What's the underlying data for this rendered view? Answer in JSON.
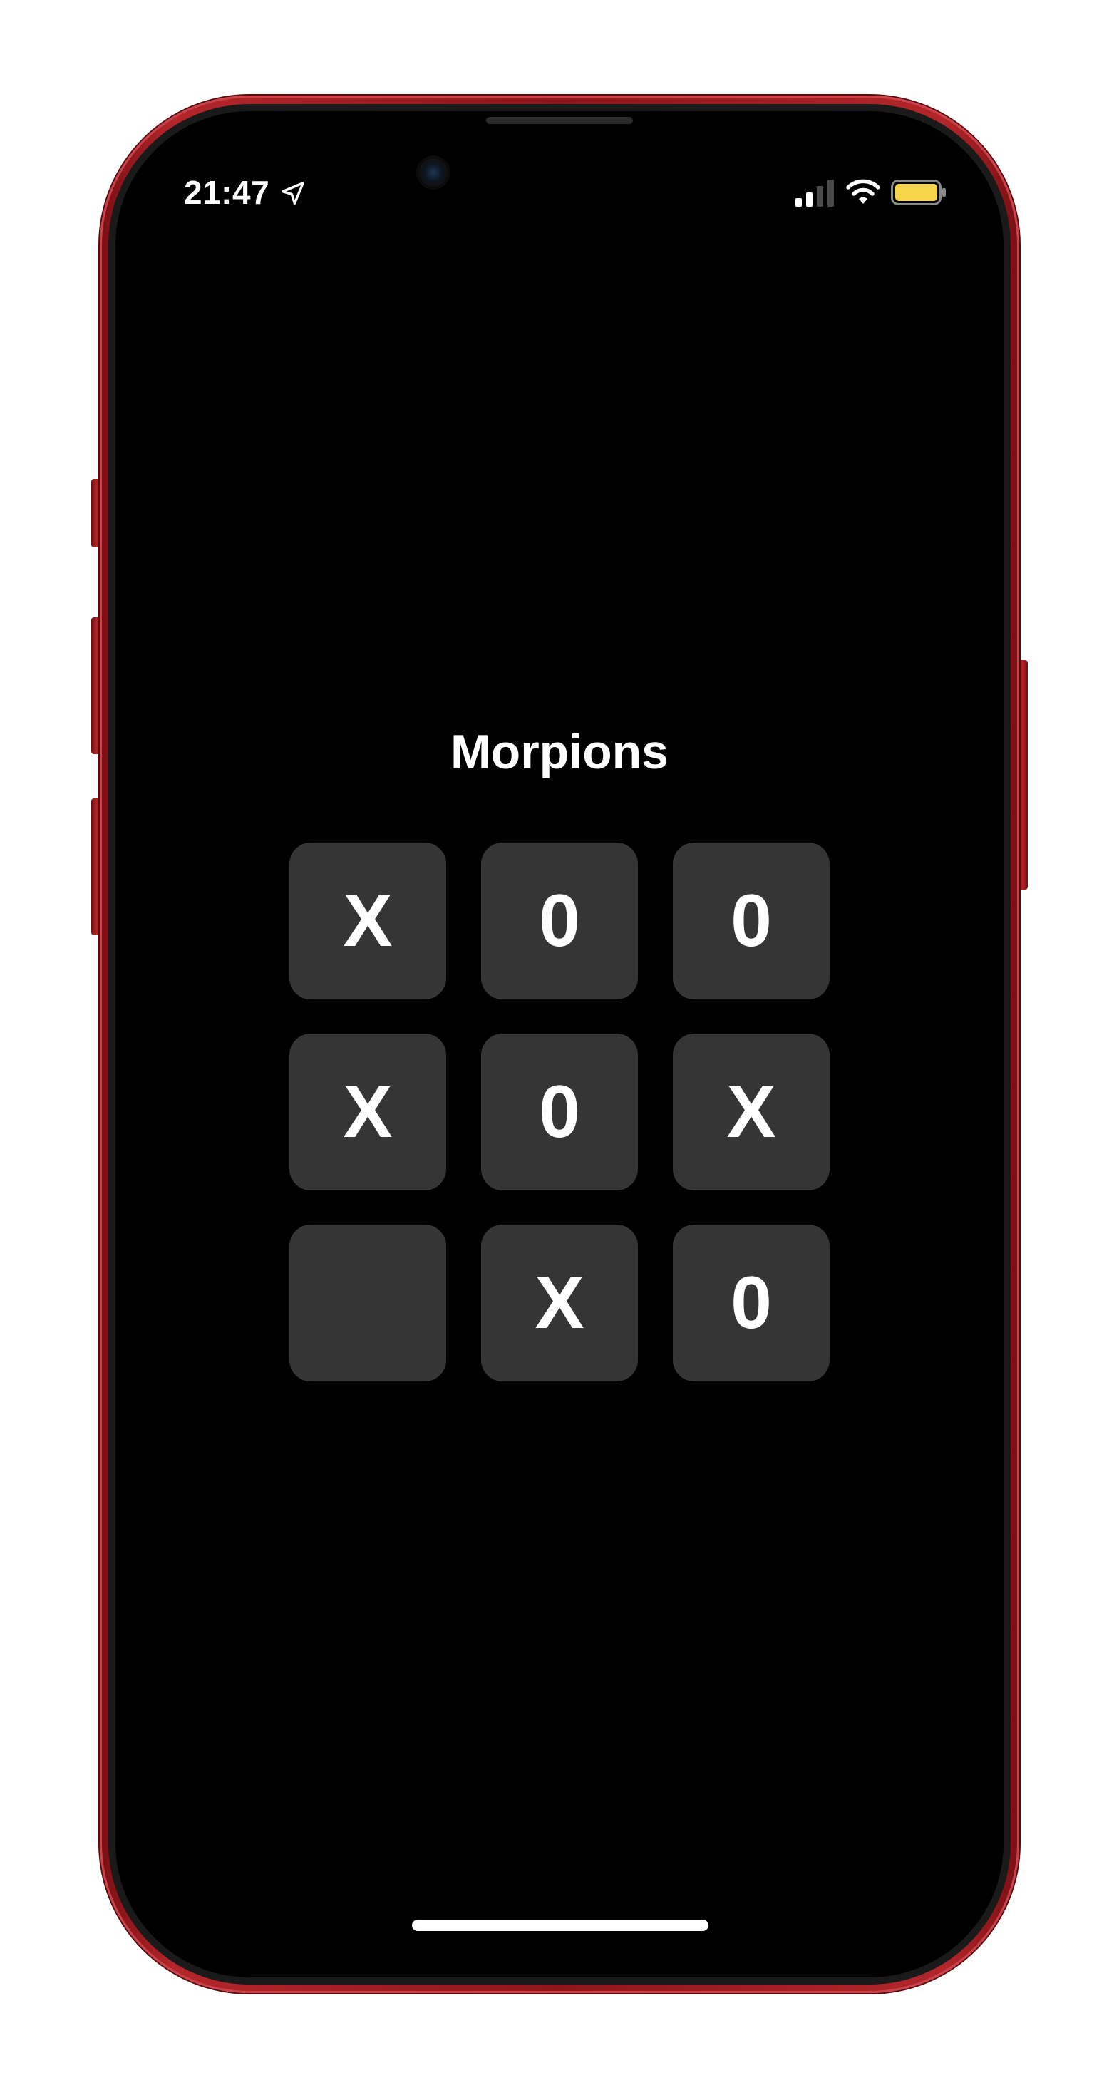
{
  "status_bar": {
    "time": "21:47",
    "icons": [
      "location-arrow-icon",
      "cellular-signal-icon",
      "wifi-icon",
      "battery-icon"
    ],
    "battery_color": "#f5d54a"
  },
  "device": {
    "frame_color": "#b3262b",
    "screen_color": "#000000"
  },
  "game": {
    "title": "Morpions",
    "cell_color": "#353535",
    "board": [
      [
        "X",
        "0",
        "0"
      ],
      [
        "X",
        "0",
        "X"
      ],
      [
        "",
        "X",
        "0"
      ]
    ]
  }
}
